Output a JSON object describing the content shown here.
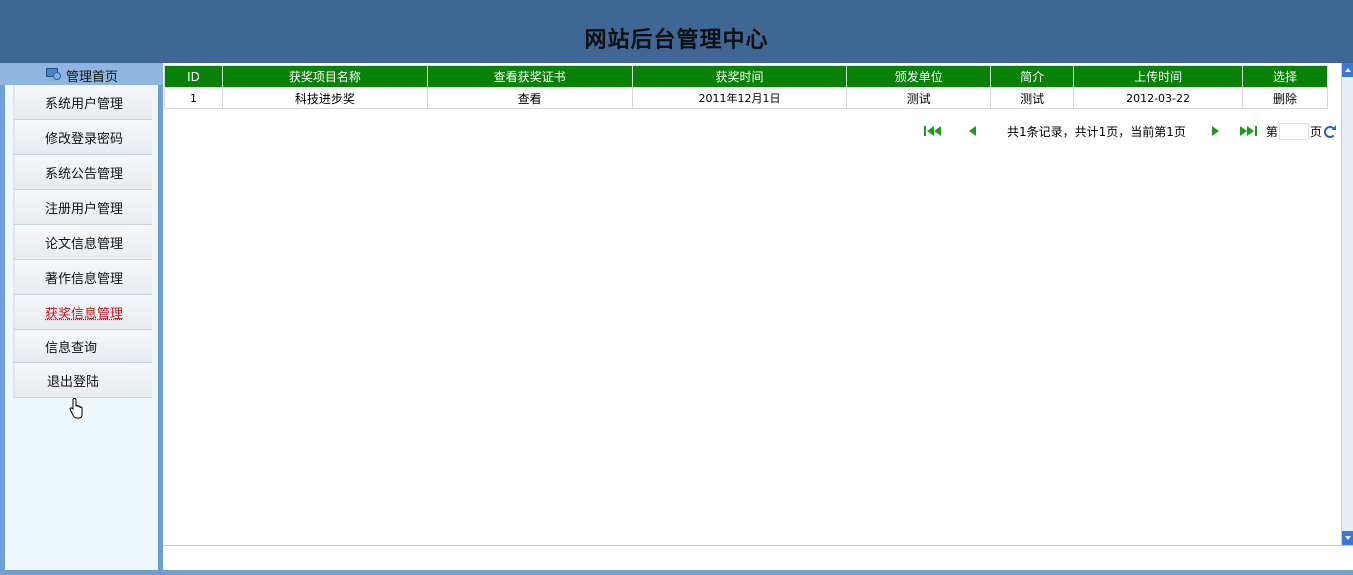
{
  "header": {
    "title": "网站后台管理中心"
  },
  "sidebar": {
    "home_label": "管理首页",
    "items": [
      {
        "label": "系统用户管理"
      },
      {
        "label": "修改登录密码"
      },
      {
        "label": "系统公告管理"
      },
      {
        "label": "注册用户管理"
      },
      {
        "label": "论文信息管理"
      },
      {
        "label": "著作信息管理"
      },
      {
        "label": "获奖信息管理",
        "active": true
      },
      {
        "label": "信息查询"
      },
      {
        "label": "退出登陆"
      }
    ]
  },
  "table": {
    "columns": [
      "ID",
      "获奖项目名称",
      "查看获奖证书",
      "获奖时间",
      "颁发单位",
      "简介",
      "上传时间",
      "选择"
    ],
    "rows": [
      {
        "id": "1",
        "name": "科技进步奖",
        "view": "查看",
        "date": "2011年12月1日",
        "issuer": "测试",
        "intro": "测试",
        "upload": "2012-03-22",
        "action": "删除"
      }
    ]
  },
  "pager": {
    "info": "共1条记录，共计1页，当前第1页",
    "page_prefix": "第",
    "page_suffix": "页",
    "page_input_value": ""
  },
  "colors": {
    "header_bg": "#3e6795",
    "table_header_bg": "#078207",
    "active_menu": "#c0141c",
    "sidebar_bg": "#eef8fb"
  }
}
